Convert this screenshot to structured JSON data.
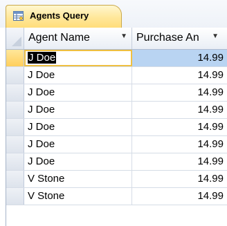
{
  "tab": {
    "icon": "query-icon",
    "title": "Agents Query"
  },
  "columns": [
    {
      "label": "Agent Name",
      "icon": "dropdown-arrow-icon"
    },
    {
      "label": "Purchase An",
      "icon": "dropdown-arrow-icon"
    }
  ],
  "rows": [
    {
      "agent_name": "J Doe",
      "purchase_amount": "14.99",
      "current": true
    },
    {
      "agent_name": "J Doe",
      "purchase_amount": "14.99"
    },
    {
      "agent_name": "J Doe",
      "purchase_amount": "14.99"
    },
    {
      "agent_name": "J Doe",
      "purchase_amount": "14.99"
    },
    {
      "agent_name": "J Doe",
      "purchase_amount": "14.99"
    },
    {
      "agent_name": "J Doe",
      "purchase_amount": "14.99"
    },
    {
      "agent_name": "J Doe",
      "purchase_amount": "14.99"
    },
    {
      "agent_name": "V Stone",
      "purchase_amount": "14.99"
    },
    {
      "agent_name": "V Stone",
      "purchase_amount": "14.99"
    }
  ],
  "colors": {
    "tab_active": "#ffe79a",
    "selection_highlight": "#b9d4f2",
    "current_row_selector": "#ffcf5c"
  }
}
